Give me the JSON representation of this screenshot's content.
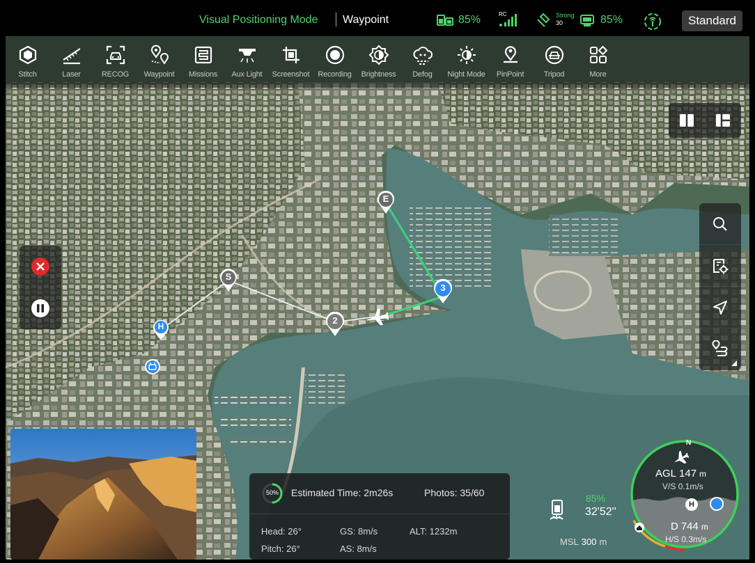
{
  "status": {
    "mode": "Visual Positioning Mode",
    "mission": "Waypoint",
    "drone_battery": "85%",
    "rc_label": "RC",
    "signal_text": "Strong",
    "sat_count": "30",
    "rc_battery": "85%",
    "standard_label": "Standard",
    "accent_color": "#4fd36a"
  },
  "toolbar": [
    {
      "label": "Stitch",
      "icon": "stitch-icon"
    },
    {
      "label": "Laser",
      "icon": "laser-icon"
    },
    {
      "label": "RECOG",
      "icon": "recog-icon"
    },
    {
      "label": "Waypoint",
      "icon": "waypoint-icon"
    },
    {
      "label": "Missions",
      "icon": "missions-icon"
    },
    {
      "label": "Aux Light",
      "icon": "aux-light-icon"
    },
    {
      "label": "Screenshot",
      "icon": "screenshot-icon"
    },
    {
      "label": "Recording",
      "icon": "recording-icon"
    },
    {
      "label": "Brightness",
      "icon": "brightness-icon"
    },
    {
      "label": "Defog",
      "icon": "defog-icon"
    },
    {
      "label": "Night Mode",
      "icon": "night-mode-icon"
    },
    {
      "label": "PinPoint",
      "icon": "pinpoint-icon"
    },
    {
      "label": "Tripod",
      "icon": "tripod-icon"
    },
    {
      "label": "More",
      "icon": "more-icon"
    }
  ],
  "map_markers": {
    "start": "S",
    "end": "E",
    "home": "H",
    "wp2": "2",
    "wp3": "3"
  },
  "mission_info": {
    "progress": "50%",
    "est_time": "Estimated Time: 2m26s",
    "photos": "Photos: 35/60",
    "head": "Head: 26°",
    "pitch": "Pitch: 26°",
    "gs": "GS: 8m/s",
    "as": "AS: 8m/s",
    "alt": "ALT: 1232m"
  },
  "telemetry": {
    "battery": "85%",
    "flight_time": "32'52''",
    "msl_label": "MSL",
    "msl_value": "300",
    "msl_unit": "m"
  },
  "compass": {
    "north": "N",
    "agl_label": "AGL",
    "agl_value": "147",
    "agl_unit": "m",
    "vs": "V/S 0.1m/s",
    "home": "H",
    "d_label": "D",
    "d_value": "744",
    "d_unit": "m",
    "hs": "H/S 0.3m/s"
  }
}
